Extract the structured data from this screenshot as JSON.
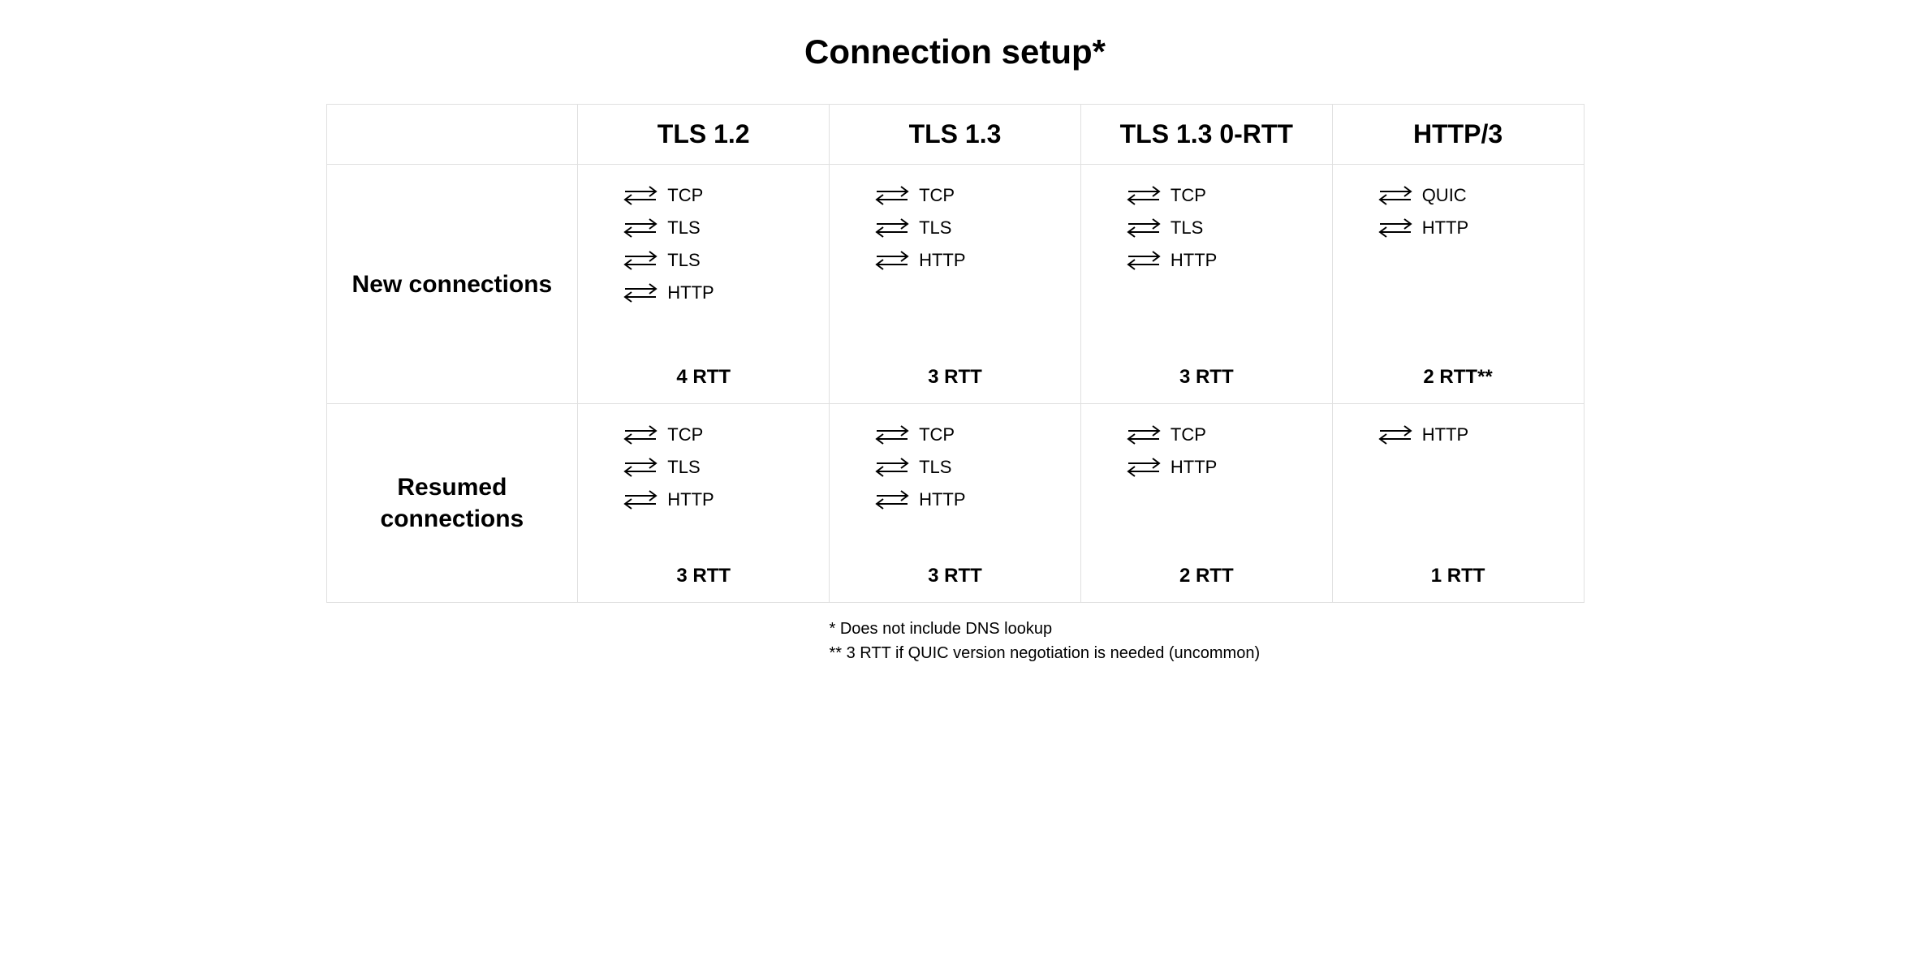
{
  "title": "Connection setup*",
  "columns": [
    "TLS 1.2",
    "TLS 1.3",
    "TLS 1.3 0-RTT",
    "HTTP/3"
  ],
  "rows": [
    {
      "label": "New connections",
      "cells": [
        {
          "steps": [
            "TCP",
            "TLS",
            "TLS",
            "HTTP"
          ],
          "rtt": "4 RTT"
        },
        {
          "steps": [
            "TCP",
            "TLS",
            "HTTP"
          ],
          "rtt": "3 RTT"
        },
        {
          "steps": [
            "TCP",
            "TLS",
            "HTTP"
          ],
          "rtt": "3 RTT"
        },
        {
          "steps": [
            "QUIC",
            "HTTP"
          ],
          "rtt": "2 RTT**"
        }
      ]
    },
    {
      "label": "Resumed connections",
      "cells": [
        {
          "steps": [
            "TCP",
            "TLS",
            "HTTP"
          ],
          "rtt": "3 RTT"
        },
        {
          "steps": [
            "TCP",
            "TLS",
            "HTTP"
          ],
          "rtt": "3 RTT"
        },
        {
          "steps": [
            "TCP",
            "HTTP"
          ],
          "rtt": "2 RTT"
        },
        {
          "steps": [
            "HTTP"
          ],
          "rtt": "1 RTT"
        }
      ]
    }
  ],
  "footnotes": [
    "* Does not include DNS lookup",
    "** 3 RTT if QUIC version negotiation is needed (uncommon)"
  ]
}
